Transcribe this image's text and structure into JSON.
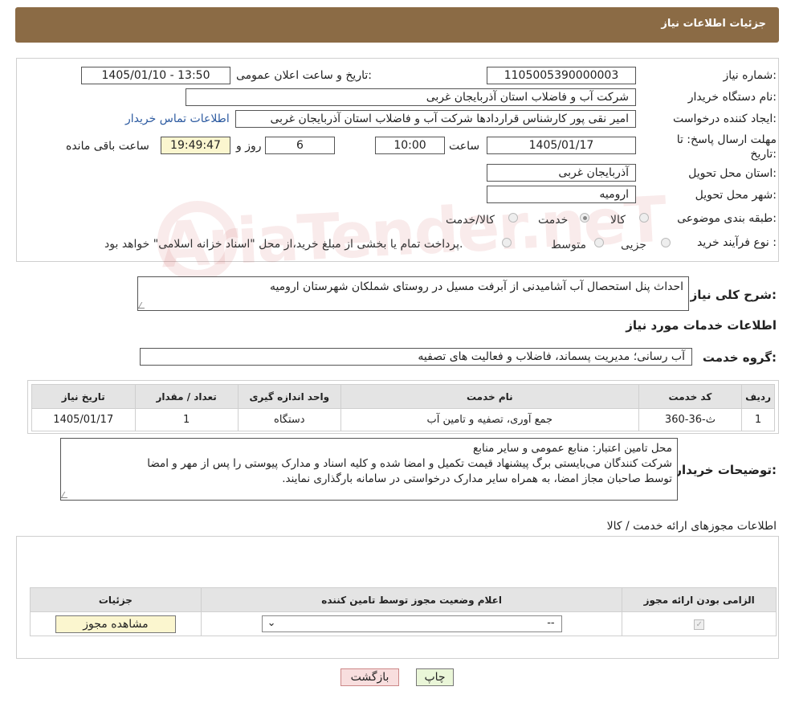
{
  "header": {
    "title": "جزئیات اطلاعات نیاز"
  },
  "watermark": {
    "text": "AriaTender.neT"
  },
  "form": {
    "need_number": {
      "label": "شماره نیاز:",
      "value": "1105005390000003"
    },
    "announce_datetime": {
      "label": "تاریخ و ساعت اعلان عمومی:",
      "value": "1405/01/10 - 13:50"
    },
    "buyer_org": {
      "label": "نام دستگاه خریدار:",
      "value": "شرکت آب و فاضلاب استان آذربایجان غربی"
    },
    "requester": {
      "label": "ایجاد کننده درخواست:",
      "value": "امیر نقی پور کارشناس قراردادها شرکت آب و فاضلاب استان آذربایجان غربی",
      "contact_link": "اطلاعات تماس خریدار"
    },
    "deadline": {
      "label": "مهلت ارسال پاسخ: تا تاریخ:",
      "date": "1405/01/17",
      "time_label": "ساعت",
      "time": "10:00",
      "days": "6",
      "days_label": "روز و",
      "remaining": "19:49:47",
      "remaining_label": "ساعت باقی مانده"
    },
    "province": {
      "label": "استان محل تحویل:",
      "value": "آذربایجان غربی"
    },
    "city": {
      "label": "شهر محل تحویل:",
      "value": "ارومیه"
    },
    "category": {
      "label": "طبقه بندی موضوعی:",
      "options": [
        "کالا",
        "خدمت",
        "کالا/خدمت"
      ],
      "selected": "خدمت"
    },
    "purchase_type": {
      "label": "نوع فرآیند خرید :",
      "options": [
        "جزیی",
        "متوسط"
      ],
      "note": "پرداخت تمام یا بخشی از مبلغ خرید،از محل \"اسناد خزانه اسلامی\" خواهد بود."
    },
    "summary": {
      "label": "شرح کلی نیاز:",
      "value": "احداث پنل استحصال آب آشامیدنی از آبرفت مسیل در روستای شملکان شهرستان ارومیه"
    },
    "services_title": "اطلاعات خدمات مورد نیاز",
    "service_group": {
      "label": "گروه خدمت:",
      "value": "آب رسانی؛ مدیریت پسماند، فاضلاب و فعالیت های تصفیه"
    }
  },
  "services_table": {
    "headers": [
      "ردیف",
      "کد خدمت",
      "نام خدمت",
      "واحد اندازه گیری",
      "تعداد / مقدار",
      "تاریخ نیاز"
    ],
    "rows": [
      [
        "1",
        "ث-36-360",
        "جمع آوری، تصفیه و تامین آب",
        "دستگاه",
        "1",
        "1405/01/17"
      ]
    ]
  },
  "buyer_notes": {
    "label": "توضیحات خریدار:",
    "lines": [
      "محل تامین اعتبار: منابع عمومی و سایر منابع",
      "شرکت کنندگان می‌بایستی برگ پیشنهاد قیمت تکمیل و امضا شده و کلیه اسناد و مدارک پیوستی را پس از مهر و امضا",
      "توسط صاحبان مجاز امضا، به همراه سایر مدارک درخواستی در سامانه بارگذاری نمایند."
    ]
  },
  "permits": {
    "title": "اطلاعات مجوزهای ارائه خدمت / کالا",
    "headers": [
      "الزامی بودن ارائه مجوز",
      "اعلام وضعیت مجوز توسط تامین کننده",
      "جزئیات"
    ],
    "select_value": "--",
    "view_button": "مشاهده مجوز"
  },
  "footer": {
    "print_label": "چاپ",
    "back_label": "بازگشت"
  },
  "colors": {
    "header_bg": "#8b6b45",
    "yellow_field": "#fbf6cf",
    "back_button": "#f8dede",
    "print_button": "#eaf6d8",
    "link": "#2c5aa0"
  }
}
